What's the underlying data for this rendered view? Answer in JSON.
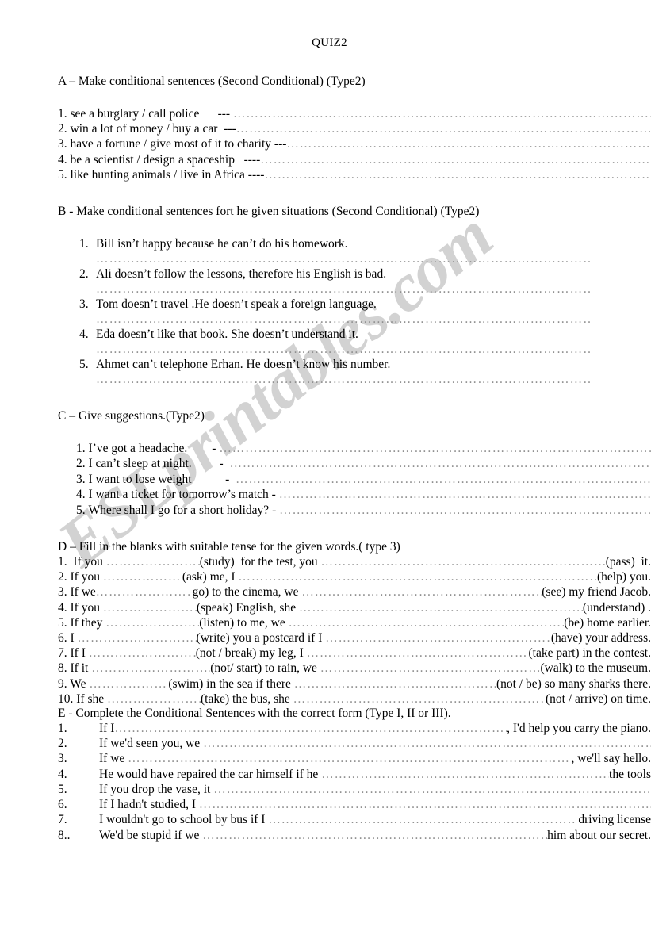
{
  "document": {
    "title": "QUIZ2",
    "watermark": "ESLprintables.com",
    "watermark_color": "#d2d2d2"
  },
  "sections": {
    "a": {
      "heading": "A – Make conditional sentences (Second Conditional) (Type2)",
      "items": [
        {
          "number": "1.",
          "prompt": "see a burglary  /  call police",
          "dashes": "---"
        },
        {
          "number": "2.",
          "prompt": "win a lot of money  / buy a car",
          "dashes": "---"
        },
        {
          "number": "3.",
          "prompt": "have a fortune  / give most of it to charity",
          "dashes": "---"
        },
        {
          "number": "4.",
          "prompt": "be a scientist   / design a spaceship",
          "dashes": "----"
        },
        {
          "number": "5.",
          "prompt": "like hunting animals / live in Africa",
          "dashes": "----"
        }
      ]
    },
    "b": {
      "heading": "B - Make conditional sentences fort he given situations (Second Conditional) (Type2)",
      "items": [
        {
          "number": "1.",
          "text": "Bill isn’t happy because he can’t do his homework."
        },
        {
          "number": "2.",
          "text": "Ali doesn’t follow the lessons, therefore his English is bad."
        },
        {
          "number": "3.",
          "text": "Tom doesn’t travel .He doesn’t speak a foreign language."
        },
        {
          "number": "4.",
          "text": "Eda doesn’t like that book. She doesn’t understand it."
        },
        {
          "number": "5.",
          "text": "Ahmet can’t telephone Erhan. He doesn’t know his number."
        }
      ]
    },
    "c": {
      "heading": "C – Give suggestions.(Type2)",
      "items": [
        {
          "number": "1.",
          "prompt": "I’ve got a headache.",
          "dash": "-"
        },
        {
          "number": "2.",
          "prompt": "I can’t sleep at night.",
          "dash": "-"
        },
        {
          "number": "3.",
          "prompt": "I want to lose weight",
          "dash": "-"
        },
        {
          "number": "4.",
          "prompt": "I want a ticket for tomorrow’s match",
          "dash": "-"
        },
        {
          "number": "5.",
          "prompt": "Where shall I go for a short holiday?",
          "dash": "-"
        }
      ]
    },
    "d": {
      "heading": "D – Fill in the blanks with suitable tense for the given words.( type 3)",
      "items": [
        {
          "number": "1.",
          "part1": "  If you ",
          "cue1": "(study)  for the test, you ",
          "cue2": "(pass)  it."
        },
        {
          "number": "2.",
          "part1": " If you ",
          "cue1": "(ask) me, I ",
          "cue2": "(help) you."
        },
        {
          "number": "3.",
          "part1": " If we",
          "cue1": " go) to the cinema, we ",
          "cue2": "(see) my friend Jacob."
        },
        {
          "number": "4.",
          "part1": " If you ",
          "cue1": "(speak) English, she ",
          "cue2": "(understand) ."
        },
        {
          "number": "5.",
          "part1": " If they ",
          "cue1": "(listen) to me, we ",
          "cue2": "(be) home earlier."
        },
        {
          "number": "6.",
          "part1": " I ",
          "cue1": "(write) you a postcard if I ",
          "cue2": "(have) your address."
        },
        {
          "number": "7.",
          "part1": " If I ",
          "cue1": "(not / break) my leg, I ",
          "cue2": "(take part) in the contest."
        },
        {
          "number": "8.",
          "part1": " If it ",
          "cue1": "(not/ start) to rain, we ",
          "cue2": "(walk) to the museum."
        },
        {
          "number": "9.",
          "part1": " We ",
          "cue1": "(swim) in the sea if there ",
          "cue2": "(not / be) so many sharks there."
        },
        {
          "number": "10.",
          "part1": " If she ",
          "cue1": "(take) the bus, she ",
          "cue2": "(not / arrive) on time."
        }
      ]
    },
    "e": {
      "heading": "E - Complete the Conditional Sentences with the correct form (Type I, II or III).",
      "items": [
        {
          "number": "1.",
          "part1": "If I",
          "tail": ", I'd help you carry the piano."
        },
        {
          "number": "2.",
          "part1": "If we'd seen you, we ",
          "tail": ""
        },
        {
          "number": "3.",
          "part1": "If we ",
          "tail": ", we'll say hello."
        },
        {
          "number": "4.",
          "part1": "He would have repaired the car himself if he ",
          "tail": "the tools"
        },
        {
          "number": "5.",
          "part1": "If you drop the vase, it ",
          "tail": ""
        },
        {
          "number": "6.",
          "part1": "If I hadn't studied, I ",
          "tail": ""
        },
        {
          "number": "7.",
          "part1": "I wouldn't go to school by bus if I ",
          "tail": " driving license"
        },
        {
          "number": "8..",
          "part1": "We'd be stupid if we ",
          "tail": "him about our secret."
        }
      ]
    }
  },
  "fill": {
    "dots_long": "……………………………………………………………………………………………………………………………………………",
    "dots_med": "………………………………………",
    "dots_short": "………………"
  }
}
